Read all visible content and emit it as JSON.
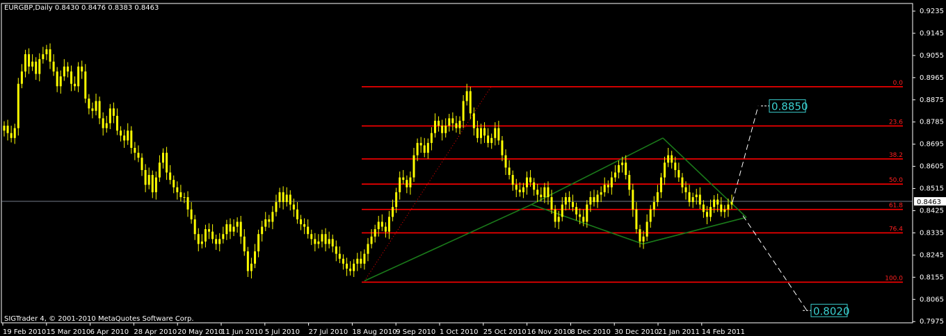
{
  "header": {
    "title": "EURGBP,Daily  0.8430 0.8476 0.8383 0.8463"
  },
  "footer": {
    "copyright": "SIGTrader 4, © 2001-2010 MetaQuotes Software Corp."
  },
  "colors": {
    "background": "#000000",
    "frame": "#ffffff",
    "candle": "#ffff00",
    "fib": "#ff0000",
    "pattern": "#1a7a1a",
    "target_box": "#3ad0d0",
    "projection": "#ffffff",
    "current_line": "#9aa7b8"
  },
  "chart_data": {
    "type": "candlestick",
    "symbol": "EURGBP",
    "timeframe": "Daily",
    "ohlc_current": {
      "open": 0.843,
      "high": 0.8476,
      "low": 0.8383,
      "close": 0.8463
    },
    "current_price_label": "0.8463",
    "ylim": [
      0.797,
      0.9266
    ],
    "y_ticks": [
      "0.9235",
      "0.9145",
      "0.9055",
      "0.8965",
      "0.8875",
      "0.8785",
      "0.8695",
      "0.8605",
      "0.8515",
      "0.8425",
      "0.8335",
      "0.8245",
      "0.8155",
      "0.8065",
      "0.7975"
    ],
    "x_ticks": [
      "19 Feb 2010",
      "15 Mar 2010",
      "6 Apr 2010",
      "28 Apr 2010",
      "20 May 2010",
      "11 Jun 2010",
      "5 Jul 2010",
      "27 Jul 2010",
      "18 Aug 2010",
      "9 Sep 2010",
      "1 Oct 2010",
      "25 Oct 2010",
      "16 Nov 2010",
      "8 Dec 2010",
      "30 Dec 2010",
      "21 Jan 2011",
      "14 Feb 2011"
    ],
    "closes": [
      0.877,
      0.874,
      0.872,
      0.876,
      0.894,
      0.899,
      0.906,
      0.901,
      0.903,
      0.898,
      0.904,
      0.906,
      0.908,
      0.903,
      0.899,
      0.893,
      0.897,
      0.901,
      0.899,
      0.894,
      0.893,
      0.901,
      0.899,
      0.888,
      0.884,
      0.883,
      0.887,
      0.88,
      0.876,
      0.878,
      0.884,
      0.881,
      0.875,
      0.873,
      0.871,
      0.875,
      0.868,
      0.866,
      0.864,
      0.859,
      0.853,
      0.857,
      0.85,
      0.856,
      0.862,
      0.866,
      0.858,
      0.855,
      0.852,
      0.85,
      0.848,
      0.848,
      0.843,
      0.839,
      0.833,
      0.829,
      0.83,
      0.835,
      0.834,
      0.831,
      0.829,
      0.831,
      0.833,
      0.837,
      0.834,
      0.836,
      0.838,
      0.832,
      0.826,
      0.818,
      0.821,
      0.826,
      0.833,
      0.836,
      0.839,
      0.838,
      0.842,
      0.846,
      0.85,
      0.846,
      0.849,
      0.845,
      0.843,
      0.839,
      0.837,
      0.836,
      0.833,
      0.831,
      0.829,
      0.83,
      0.833,
      0.829,
      0.831,
      0.828,
      0.825,
      0.823,
      0.821,
      0.819,
      0.818,
      0.821,
      0.823,
      0.821,
      0.825,
      0.829,
      0.832,
      0.835,
      0.838,
      0.836,
      0.834,
      0.84,
      0.844,
      0.85,
      0.856,
      0.855,
      0.852,
      0.856,
      0.865,
      0.87,
      0.869,
      0.866,
      0.87,
      0.874,
      0.879,
      0.877,
      0.874,
      0.877,
      0.88,
      0.878,
      0.876,
      0.879,
      0.887,
      0.891,
      0.882,
      0.876,
      0.872,
      0.876,
      0.873,
      0.87,
      0.872,
      0.876,
      0.871,
      0.865,
      0.86,
      0.857,
      0.853,
      0.851,
      0.85,
      0.852,
      0.856,
      0.854,
      0.851,
      0.849,
      0.848,
      0.852,
      0.848,
      0.843,
      0.838,
      0.84,
      0.845,
      0.848,
      0.846,
      0.844,
      0.841,
      0.84,
      0.838,
      0.845,
      0.848,
      0.846,
      0.849,
      0.85,
      0.853,
      0.852,
      0.856,
      0.858,
      0.861,
      0.862,
      0.857,
      0.851,
      0.843,
      0.835,
      0.83,
      0.832,
      0.838,
      0.843,
      0.846,
      0.85,
      0.856,
      0.862,
      0.865,
      0.862,
      0.859,
      0.856,
      0.852,
      0.85,
      0.846,
      0.848,
      0.849,
      0.845,
      0.842,
      0.84,
      0.844,
      0.847,
      0.845,
      0.842,
      0.843,
      0.845,
      0.846
    ]
  },
  "fib_levels": [
    {
      "label": "0.0",
      "price": 0.8928
    },
    {
      "label": "23.6",
      "price": 0.8769
    },
    {
      "label": "38.2",
      "price": 0.8635
    },
    {
      "label": "50.0",
      "price": 0.8533
    },
    {
      "label": "61.8",
      "price": 0.843
    },
    {
      "label": "76.4",
      "price": 0.8335
    },
    {
      "label": "100.0",
      "price": 0.8135
    }
  ],
  "targets": [
    {
      "label": "0.8850",
      "price": 0.885
    },
    {
      "label": "0.8020",
      "price": 0.802
    }
  ]
}
